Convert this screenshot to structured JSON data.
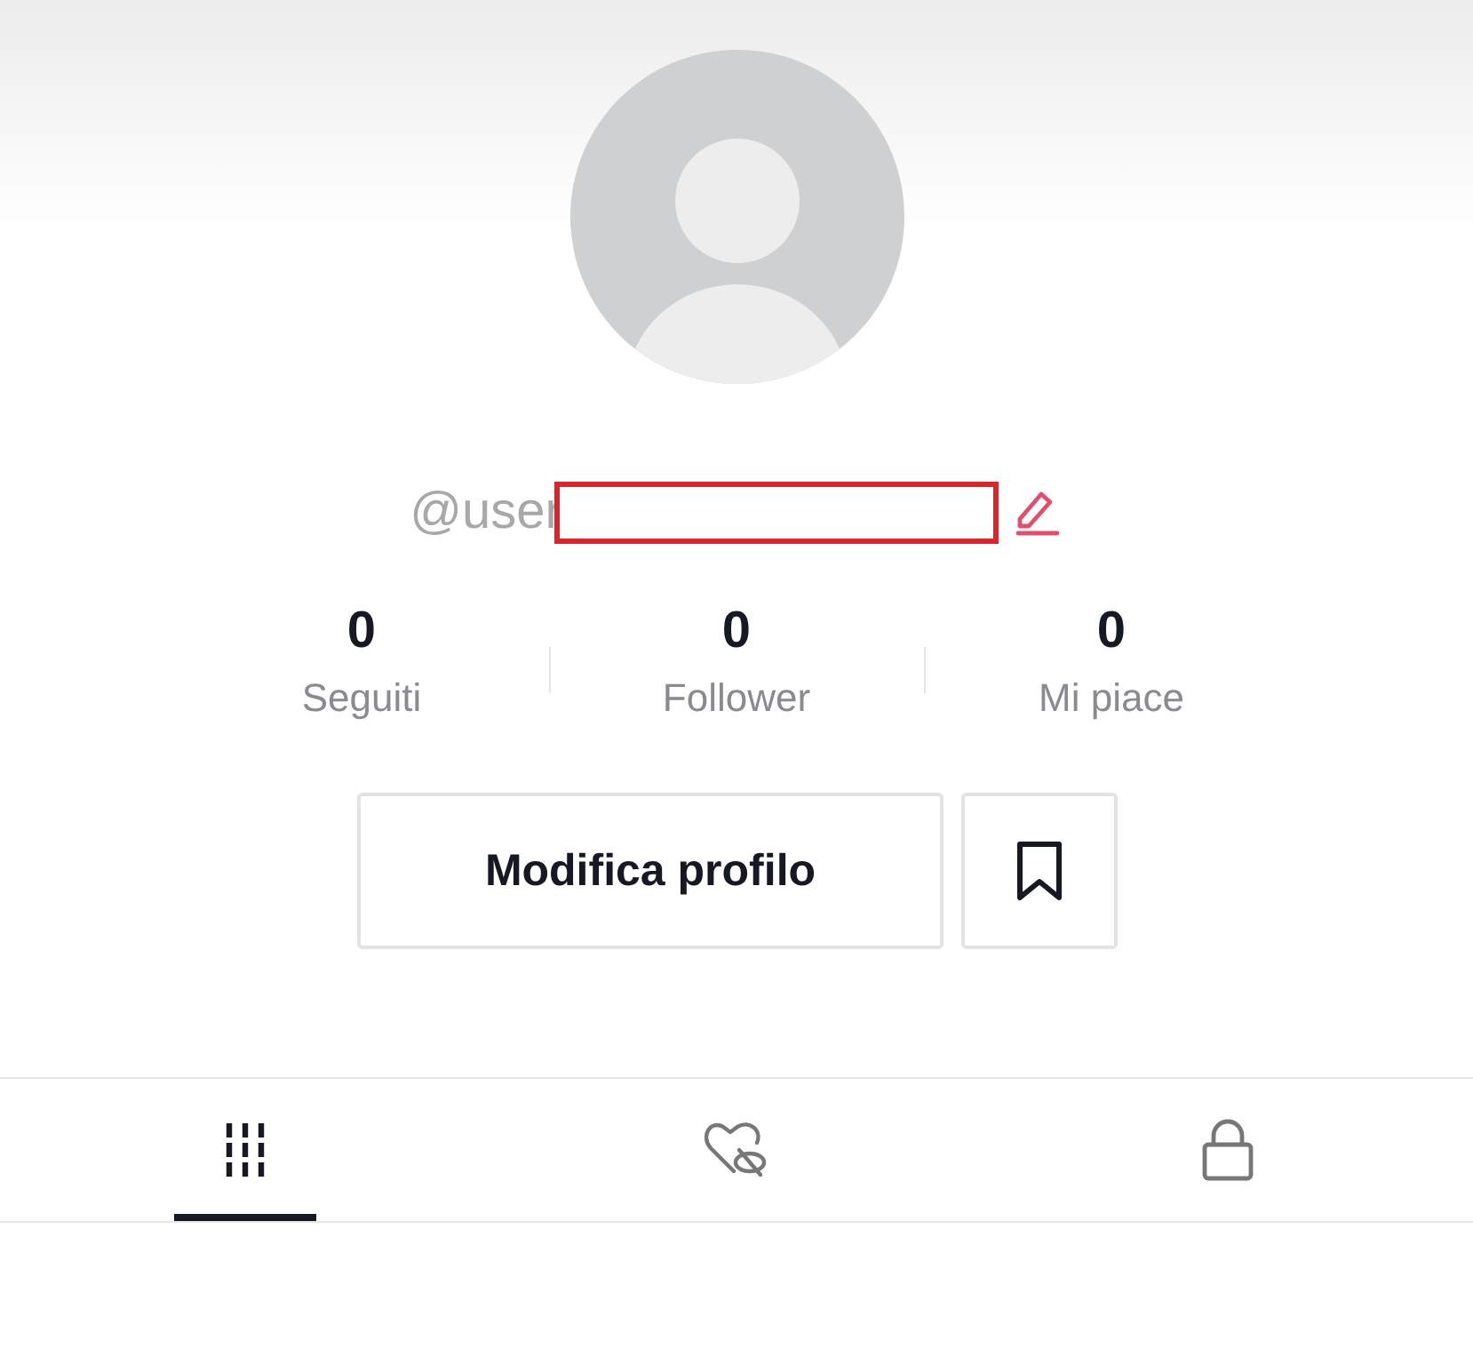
{
  "profile": {
    "username": "@user"
  },
  "stats": [
    {
      "value": "0",
      "label": "Seguiti"
    },
    {
      "value": "0",
      "label": "Follower"
    },
    {
      "value": "0",
      "label": "Mi piace"
    }
  ],
  "edit_button": "Modifica profilo",
  "tabs": [
    {
      "kind": "grid",
      "selected": true
    },
    {
      "kind": "liked",
      "selected": false
    },
    {
      "kind": "private",
      "selected": false
    }
  ]
}
